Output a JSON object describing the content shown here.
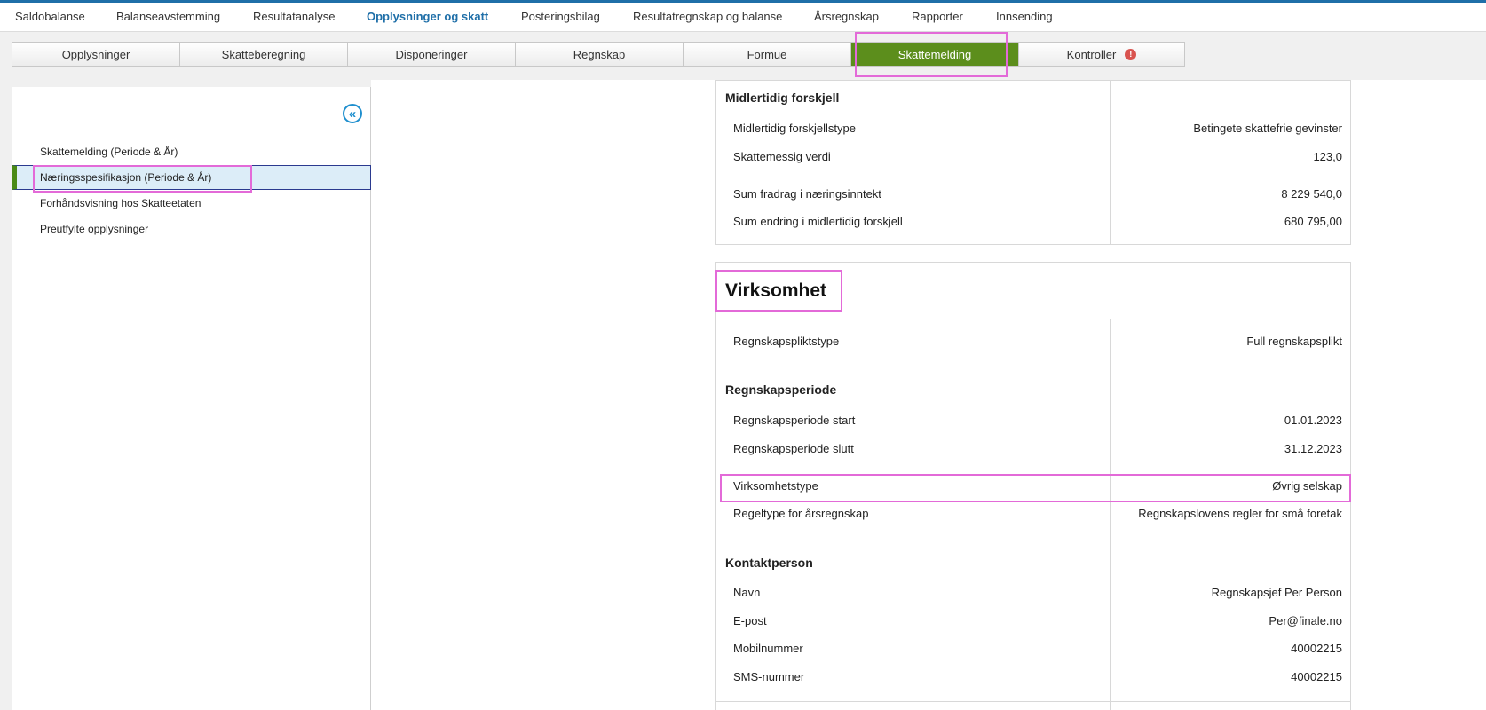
{
  "top_nav": [
    "Saldobalanse",
    "Balanseavstemming",
    "Resultatanalyse",
    "Opplysninger og skatt",
    "Posteringsbilag",
    "Resultatregnskap og balanse",
    "Årsregnskap",
    "Rapporter",
    "Innsending"
  ],
  "tabs": [
    "Opplysninger",
    "Skatteberegning",
    "Disponeringer",
    "Regnskap",
    "Formue",
    "Skattemelding",
    "Kontroller"
  ],
  "tab_alert": "!",
  "sidebar": {
    "collapse_icon": "«",
    "items": [
      "Skattemelding (Periode & År)",
      "Næringsspesifikasjon (Periode & År)",
      "Forhåndsvisning hos Skatteetaten",
      "Preutfylte opplysninger"
    ]
  },
  "midlertidig": {
    "title": "Midlertidig forskjell",
    "rows": [
      {
        "label": "Midlertidig forskjellstype",
        "value": "Betingete skattefrie gevinster"
      },
      {
        "label": "Skattemessig verdi",
        "value": "123,0"
      },
      {
        "label": "Sum fradrag i næringsinntekt",
        "value": "8 229 540,0"
      },
      {
        "label": "Sum endring i midlertidig forskjell",
        "value": "680 795,00"
      }
    ]
  },
  "virksomhet": {
    "title": "Virksomhet",
    "regnskapsplikt": {
      "label": "Regnskapspliktstype",
      "value": "Full regnskapsplikt"
    },
    "periode_title": "Regnskapsperiode",
    "periode_rows": [
      {
        "label": "Regnskapsperiode start",
        "value": "01.01.2023"
      },
      {
        "label": "Regnskapsperiode slutt",
        "value": "31.12.2023"
      },
      {
        "label": "Virksomhetstype",
        "value": "Øvrig selskap"
      },
      {
        "label": "Regeltype for årsregnskap",
        "value": "Regnskapslovens regler for små foretak"
      }
    ],
    "kontakt_title": "Kontaktperson",
    "kontakt_rows": [
      {
        "label": "Navn",
        "value": "Regnskapsjef Per Person"
      },
      {
        "label": "E-post",
        "value": "Per@finale.no"
      },
      {
        "label": "Mobilnummer",
        "value": "40002215"
      },
      {
        "label": "SMS-nummer",
        "value": "40002215"
      }
    ]
  },
  "colors": {
    "accent_blue": "#1f6fa8",
    "active_tab_green": "#5c8e1c",
    "highlight_pink": "#e36ad8",
    "alert_red": "#d9534f"
  }
}
